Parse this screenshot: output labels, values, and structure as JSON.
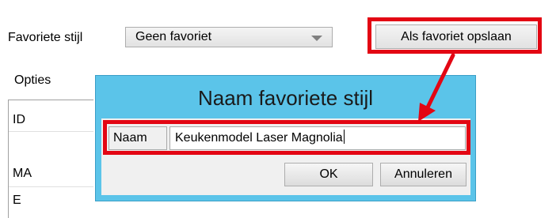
{
  "toolbar": {
    "favorite_label": "Favoriete stijl",
    "favorite_select_value": "Geen favoriet",
    "save_as_favorite_label": "Als favoriet opslaan"
  },
  "options": {
    "label": "Opties",
    "rows": [
      "ID",
      "MA",
      "E"
    ]
  },
  "dialog": {
    "title": "Naam favoriete stijl",
    "name_label": "Naam",
    "name_value": "Keukenmodel Laser Magnolia",
    "ok_label": "OK",
    "cancel_label": "Annuleren"
  },
  "colors": {
    "highlight": "#e30613",
    "dialog_frame": "#5bc4e9"
  }
}
